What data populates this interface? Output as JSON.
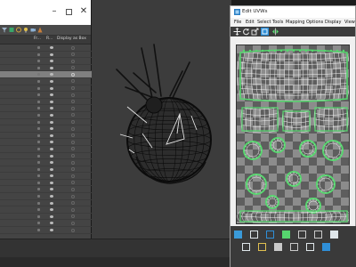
{
  "scene_explorer": {
    "window_controls": {
      "minimize": "–",
      "maximize": "",
      "close": "✕"
    },
    "columns": [
      "Fr...",
      "R...",
      "Display as Box"
    ],
    "row_count": 28,
    "selected_row": 4,
    "rows_with_dot": [
      4
    ]
  },
  "uvw_editor": {
    "title": "Edit UVWs",
    "menus": [
      "File",
      "Edit",
      "Select",
      "Tools",
      "Mapping",
      "Options",
      "Display",
      "View"
    ],
    "toolbar_icons": [
      "move-icon",
      "rotate-icon",
      "scale-icon",
      "freeform-icon",
      "mirror-icon"
    ],
    "bottom_icons": [
      "paint-icon",
      "select-vertex-icon",
      "select-edge-icon",
      "select-face-icon",
      "grow-icon",
      "shrink-icon",
      "loop-icon",
      "ring-icon",
      "lock-icon",
      "hide-icon",
      "zoom-icon",
      "pan-icon",
      "grid-icon"
    ]
  },
  "colors": {
    "panel_bg": "#444444",
    "viewport_bg": "#3c3c3c",
    "uv_green": "#56d66e",
    "wire": "#0f0f0f",
    "accent_blue": "#2f8fd8"
  }
}
